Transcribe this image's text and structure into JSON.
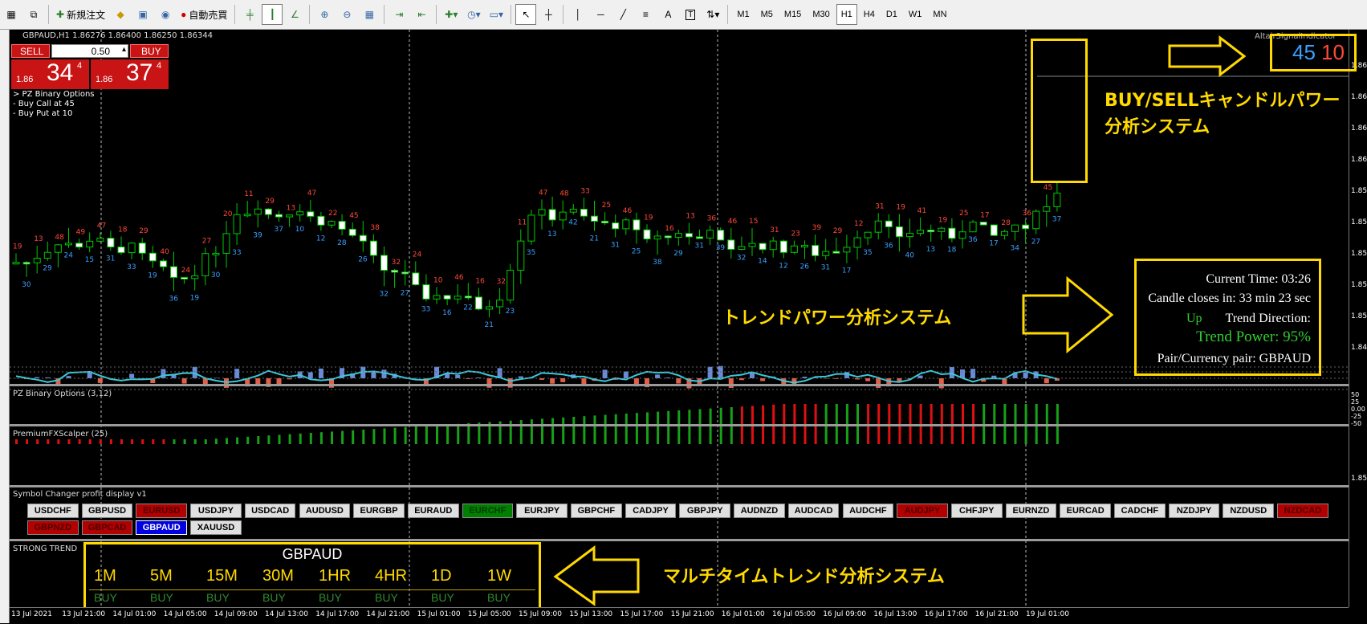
{
  "toolbar": {
    "new_order": "新規注文",
    "auto_trading": "自動売買",
    "timeframes": [
      "M1",
      "M5",
      "M15",
      "M30",
      "H1",
      "H4",
      "D1",
      "W1",
      "MN"
    ],
    "active_timeframe": "H1",
    "text_tool": "A",
    "text_label_tool": "T"
  },
  "chart": {
    "symbol_header": "GBPAUD,H1  1.86276 1.86400 1.86250 1.86344",
    "top_right_label": "AltairSignalIndicator",
    "top_right_nums": [
      "45",
      "10"
    ]
  },
  "trade_panel": {
    "sell_label": "SELL",
    "buy_label": "BUY",
    "lot": "0.50",
    "sell_prefix": "1.86",
    "sell_big": "34",
    "sell_sup": "4",
    "buy_prefix": "1.86",
    "buy_big": "37",
    "buy_sup": "4"
  },
  "binary_info": [
    "> PZ Binary Options",
    "- Buy Call at 45",
    "- Buy Put at 10"
  ],
  "annotations": {
    "candle_power": [
      "BUY/SELLキャンドルパワー",
      "分析システム"
    ],
    "trend_power": "トレンドパワー分析システム",
    "multi_time": "マルチタイムトレンド分析システム"
  },
  "trend_panel": {
    "current_time": "Current Time: 03:26",
    "candle_closes": "Candle closes in: 33 min 23 sec",
    "direction_value": "Up",
    "direction_label": "Trend Direction:",
    "power": "Trend Power: 95%",
    "pair": "Pair/Currency pair: GBPAUD"
  },
  "panes": {
    "binary": "PZ Binary Options (3,12)",
    "scalper": "PremiumFXScalper (25)",
    "symbol_changer": "Symbol Changer profit display v1",
    "strong_trend": "STRONG TREND"
  },
  "price_scale": [
    "1.86",
    "1.86",
    "1.86",
    "1.86",
    "1.85",
    "1.85",
    "1.85",
    "1.85",
    "1.85",
    "1.84"
  ],
  "binary_scale": [
    "50",
    "25",
    "0.00",
    "-25",
    "-50"
  ],
  "scalper_scale": "1.85",
  "symbols_row1": [
    {
      "name": "USDCHF",
      "state": "normal"
    },
    {
      "name": "GBPUSD",
      "state": "normal"
    },
    {
      "name": "EURUSD",
      "state": "red"
    },
    {
      "name": "USDJPY",
      "state": "normal"
    },
    {
      "name": "USDCAD",
      "state": "normal"
    },
    {
      "name": "AUDUSD",
      "state": "normal"
    },
    {
      "name": "EURGBP",
      "state": "normal"
    },
    {
      "name": "EURAUD",
      "state": "normal"
    },
    {
      "name": "EURCHF",
      "state": "green"
    },
    {
      "name": "EURJPY",
      "state": "normal"
    },
    {
      "name": "GBPCHF",
      "state": "normal"
    },
    {
      "name": "CADJPY",
      "state": "normal"
    },
    {
      "name": "GBPJPY",
      "state": "normal"
    },
    {
      "name": "AUDNZD",
      "state": "normal"
    },
    {
      "name": "AUDCAD",
      "state": "normal"
    },
    {
      "name": "AUDCHF",
      "state": "normal"
    },
    {
      "name": "AUDJPY",
      "state": "red"
    },
    {
      "name": "CHFJPY",
      "state": "normal"
    },
    {
      "name": "EURNZD",
      "state": "normal"
    },
    {
      "name": "EURCAD",
      "state": "normal"
    },
    {
      "name": "CADCHF",
      "state": "normal"
    },
    {
      "name": "NZDJPY",
      "state": "normal"
    },
    {
      "name": "NZDUSD",
      "state": "normal"
    },
    {
      "name": "NZDCAD",
      "state": "red"
    }
  ],
  "symbols_row2": [
    {
      "name": "GBPNZD",
      "state": "red"
    },
    {
      "name": "GBPCAD",
      "state": "red"
    },
    {
      "name": "GBPAUD",
      "state": "blue"
    },
    {
      "name": "XAUUSD",
      "state": "normal"
    }
  ],
  "strong_trend": {
    "symbol": "GBPAUD",
    "timeframes": [
      "1M",
      "5M",
      "15M",
      "30M",
      "1HR",
      "4HR",
      "1D",
      "1W"
    ],
    "signals": [
      "BUY",
      "BUY",
      "BUY",
      "BUY",
      "BUY",
      "BUY",
      "BUY",
      "BUY"
    ]
  },
  "date_axis": [
    "13 Jul 2021",
    "13 Jul 21:00",
    "14 Jul 01:00",
    "14 Jul 05:00",
    "14 Jul 09:00",
    "14 Jul 13:00",
    "14 Jul 17:00",
    "14 Jul 21:00",
    "15 Jul 01:00",
    "15 Jul 05:00",
    "15 Jul 09:00",
    "15 Jul 13:00",
    "15 Jul 17:00",
    "15 Jul 21:00",
    "16 Jul 01:00",
    "16 Jul 05:00",
    "16 Jul 09:00",
    "16 Jul 13:00",
    "16 Jul 17:00",
    "16 Jul 21:00",
    "19 Jul 01:00"
  ],
  "colors": {
    "bull_label": "#ff4a3a",
    "bear_label": "#3aa0ff",
    "candle_outline": "#00c800",
    "highlight": "#ffd900"
  }
}
